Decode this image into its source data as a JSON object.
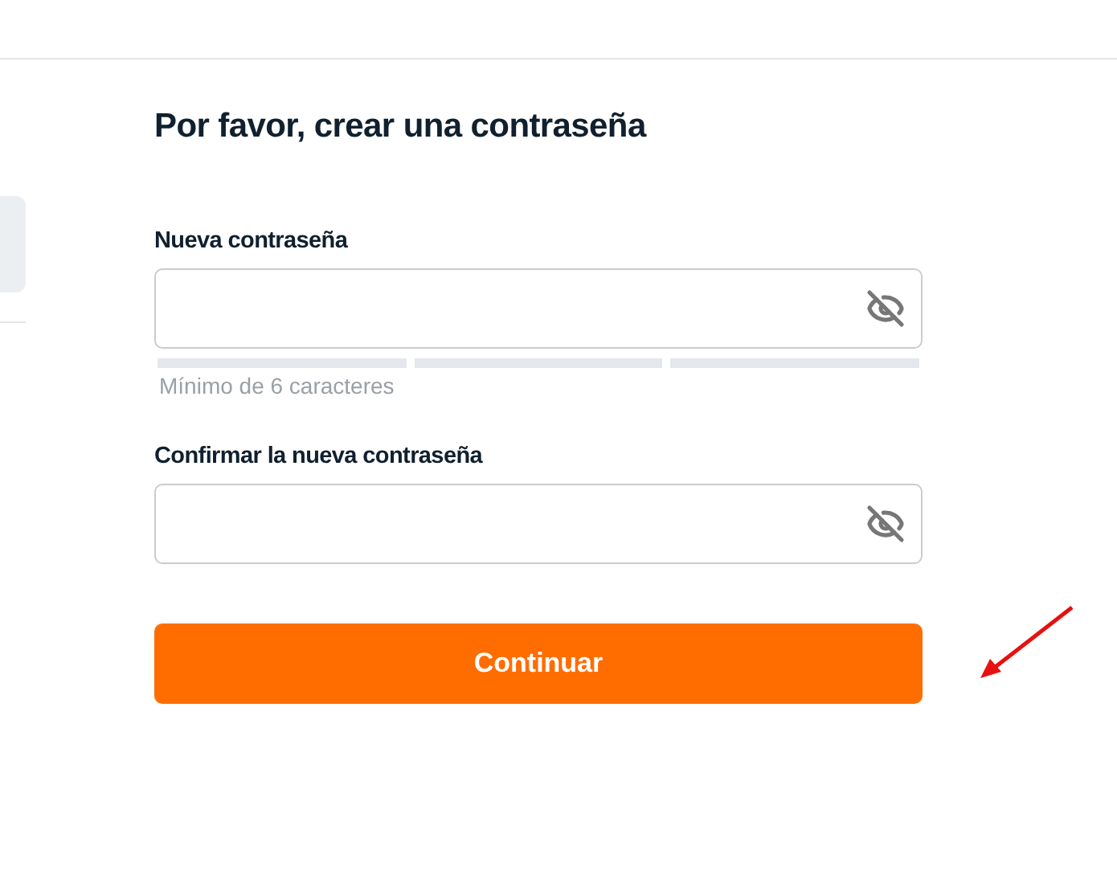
{
  "title": "Por favor, crear una contraseña",
  "fields": [
    {
      "label": "Nueva contraseña",
      "password_visible": false,
      "strength": {
        "hint": "Mínimo de 6 caracteres"
      }
    },
    {
      "label": "Confirmar la nueva contraseña",
      "password_visible": false
    }
  ],
  "button": "Continuar"
}
